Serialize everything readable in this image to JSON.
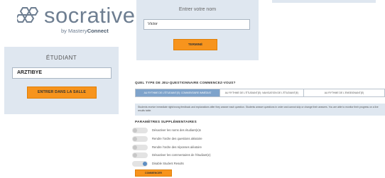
{
  "logo": {
    "word": "socrative",
    "by": "by Mastery",
    "by_bold": "Connect"
  },
  "student": {
    "title": "ÉTUDIANT",
    "room_value": "ARZTIBYE",
    "join_label": "ENTRER DANS LA SALLE"
  },
  "name_entry": {
    "title": "Entrer votre nom",
    "name_value": "Victor",
    "done_label": "TERMINÉ"
  },
  "quiz": {
    "question": "QUEL TYPE DE JEU-QUESTIONNAIRE COMMENCEZ-VOUS?",
    "pace_options": [
      "AU RYTHME DE L'ÉTUDIANT(E): COMMENTAIRE IMMÉDIAT",
      "AU RYTHME DE L'ÉTUDIANT(E): NAVIGATION DE L'ÉTUDIANT(E)",
      "AU RYTHME DE L'ENSEIGNANT(E)"
    ],
    "selected_pace_index": 0,
    "pace_description": "Students receive immediate right/wrong feedback and explanations after they answer each question. Students answer questions in order and cannot skip or change their answers. You are able to monitor their progress on a live results table.",
    "extra_title": "PARAMÈTRES SUPPLÉMENTAIRES",
    "settings": [
      {
        "label": "Désactiver les noms des étudiant(e)s",
        "on": false
      },
      {
        "label": "Rendre l'ordre des questions aléatoire",
        "on": false
      },
      {
        "label": "Rendre l'ordre des réponses aléatoire",
        "on": false
      },
      {
        "label": "Désactiver les commentaires de l'étudiant(e)",
        "on": false
      },
      {
        "label": "Disable Student Results",
        "on": true
      }
    ],
    "start_label": "COMMENCER"
  },
  "colors": {
    "accent_orange": "#f7941d",
    "panel_blue": "#dfe7f0",
    "toggle_on": "#5e8ec2",
    "selected_tab": "#7ea3cb"
  }
}
